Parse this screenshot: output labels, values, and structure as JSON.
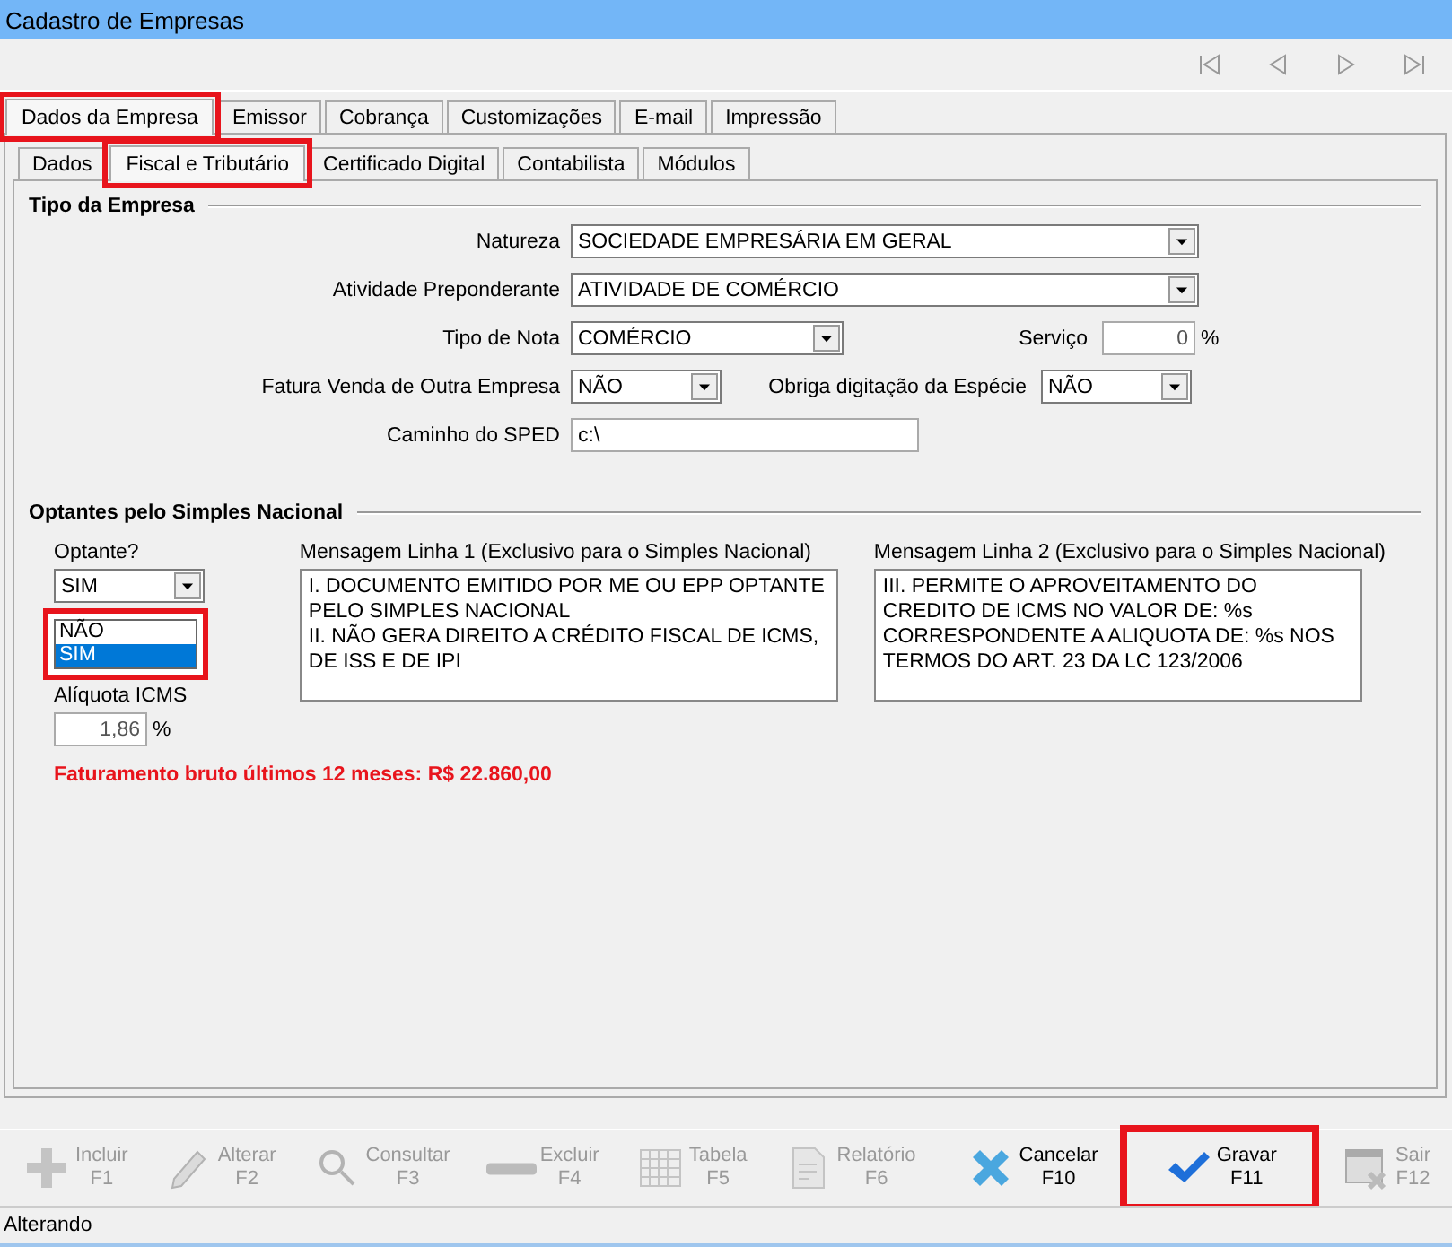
{
  "window": {
    "title": "Cadastro de Empresas"
  },
  "tabs": [
    {
      "label": "Dados da Empresa",
      "selected": true,
      "highlighted": true
    },
    {
      "label": "Emissor",
      "selected": false,
      "highlighted": false
    },
    {
      "label": "Cobrança",
      "selected": false,
      "highlighted": false
    },
    {
      "label": "Customizações",
      "selected": false,
      "highlighted": false
    },
    {
      "label": "E-mail",
      "selected": false,
      "highlighted": false
    },
    {
      "label": "Impressão",
      "selected": false,
      "highlighted": false
    }
  ],
  "subtabs": [
    {
      "label": "Dados",
      "selected": false,
      "highlighted": false
    },
    {
      "label": "Fiscal e Tributário",
      "selected": true,
      "highlighted": true
    },
    {
      "label": "Certificado Digital",
      "selected": false,
      "highlighted": false
    },
    {
      "label": "Contabilista",
      "selected": false,
      "highlighted": false
    },
    {
      "label": "Módulos",
      "selected": false,
      "highlighted": false
    }
  ],
  "tipo_empresa": {
    "title": "Tipo da Empresa",
    "natureza": {
      "label": "Natureza",
      "value": "SOCIEDADE EMPRESÁRIA EM GERAL"
    },
    "atividade": {
      "label": "Atividade Preponderante",
      "value": "ATIVIDADE DE COMÉRCIO"
    },
    "tipo_nota": {
      "label": "Tipo de Nota",
      "value": "COMÉRCIO"
    },
    "servico": {
      "label": "Serviço",
      "value": "0",
      "unit": "%"
    },
    "fatura": {
      "label": "Fatura Venda de Outra Empresa",
      "value": "NÃO"
    },
    "obriga": {
      "label": "Obriga digitação da Espécie",
      "value": "NÃO"
    },
    "sped": {
      "label": "Caminho do SPED",
      "value": "c:\\"
    }
  },
  "simples": {
    "title": "Optantes pelo Simples Nacional",
    "optante": {
      "label": "Optante?",
      "value": "SIM",
      "open": true,
      "highlighted": true,
      "options": [
        {
          "label": "NÃO",
          "selected": false
        },
        {
          "label": "SIM",
          "selected": true
        }
      ]
    },
    "aliquota": {
      "label": "Alíquota ICMS",
      "value": "1,86",
      "unit": "%"
    },
    "mensagem1": {
      "label": "Mensagem Linha 1 (Exclusivo para  o Simples Nacional)",
      "text": "I. DOCUMENTO EMITIDO POR ME OU EPP OPTANTE PELO SIMPLES NACIONAL\nII. NÃO GERA DIREITO A CRÉDITO FISCAL DE ICMS, DE ISS E DE IPI"
    },
    "mensagem2": {
      "label": "Mensagem Linha 2 (Exclusivo para o Simples Nacional)",
      "text": "III. PERMITE O APROVEITAMENTO DO CREDITO DE ICMS NO VALOR DE: %s CORRESPONDENTE A ALIQUOTA DE: %s NOS TERMOS DO ART. 23 DA LC 123/2006"
    },
    "faturamento": "Faturamento bruto últimos 12 meses: R$ 22.860,00"
  },
  "toolbar": [
    {
      "kind": "plus",
      "label": "Incluir",
      "key": "F1",
      "disabled": true,
      "highlighted": false
    },
    {
      "kind": "pencil",
      "label": "Alterar",
      "key": "F2",
      "disabled": true,
      "highlighted": false
    },
    {
      "kind": "search",
      "label": "Consultar",
      "key": "F3",
      "disabled": true,
      "highlighted": false
    },
    {
      "kind": "minus",
      "label": "Excluir",
      "key": "F4",
      "disabled": true,
      "highlighted": false
    },
    {
      "kind": "table",
      "label": "Tabela",
      "key": "F5",
      "disabled": true,
      "highlighted": false
    },
    {
      "kind": "report",
      "label": "Relatório",
      "key": "F6",
      "disabled": true,
      "highlighted": false
    },
    {
      "kind": "cancel",
      "label": "Cancelar",
      "key": "F10",
      "disabled": false,
      "highlighted": false
    },
    {
      "kind": "check",
      "label": "Gravar",
      "key": "F11",
      "disabled": false,
      "highlighted": true
    },
    {
      "kind": "exit",
      "label": "Sair",
      "key": "F12",
      "disabled": true,
      "highlighted": false
    }
  ],
  "status_bar": "Alterando"
}
